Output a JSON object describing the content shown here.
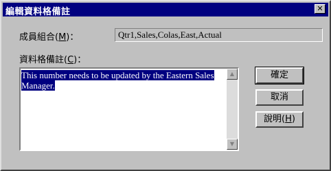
{
  "window": {
    "title": "編輯資料格備註",
    "close_glyph": "✕"
  },
  "member": {
    "label_prefix": "成員組合(",
    "label_key": "M",
    "label_suffix": ")：",
    "value": "Qtr1,Sales,Colas,East,Actual"
  },
  "note": {
    "label_prefix": "資料格備註(",
    "label_key": "C",
    "label_suffix": ")：",
    "text": "This number needs to be updated by the Eastern Sales Manager."
  },
  "buttons": {
    "ok": "確定",
    "cancel": "取消",
    "help_prefix": "說明(",
    "help_key": "H",
    "help_suffix": ")"
  },
  "colors": {
    "title_bg": "#000080",
    "face": "#c0c0c0",
    "selection": "#000080"
  },
  "scroll_up_glyph": "▲",
  "scroll_down_glyph": "▼"
}
